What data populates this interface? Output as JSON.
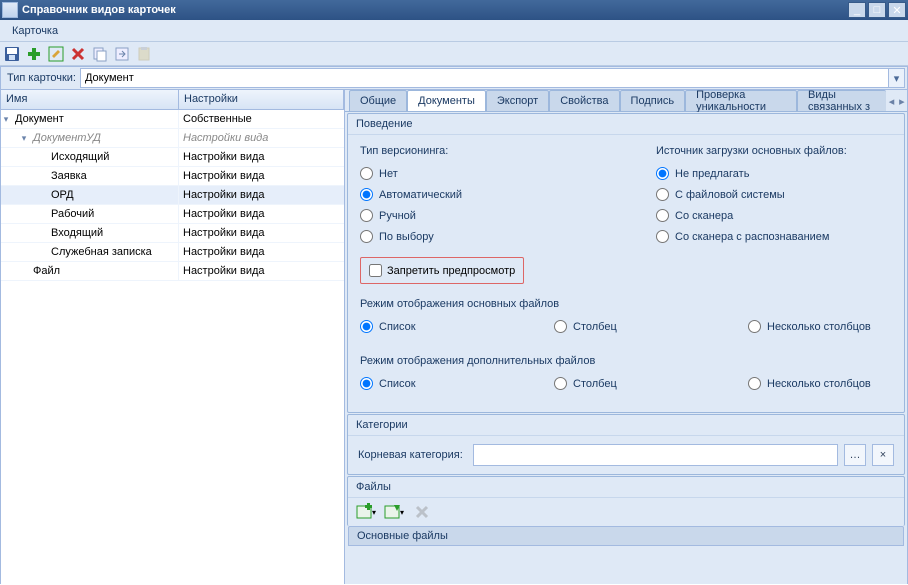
{
  "window": {
    "title": "Справочник видов карточек"
  },
  "menu": {
    "card": "Карточка"
  },
  "filter": {
    "label": "Тип карточки:",
    "value": "Документ"
  },
  "grid": {
    "col_name": "Имя",
    "col_settings": "Настройки"
  },
  "tree": [
    {
      "indent": 0,
      "toggle": "▾",
      "name": "Документ",
      "nameClass": "",
      "settings": "Собственные",
      "settingsClass": "",
      "sel": false
    },
    {
      "indent": 1,
      "toggle": "▾",
      "name": "ДокументУД",
      "nameClass": "italic",
      "settings": "Настройки вида",
      "settingsClass": "italic",
      "sel": false
    },
    {
      "indent": 2,
      "toggle": "",
      "name": "Исходящий",
      "nameClass": "",
      "settings": "Настройки вида",
      "settingsClass": "",
      "sel": false
    },
    {
      "indent": 2,
      "toggle": "",
      "name": "Заявка",
      "nameClass": "",
      "settings": "Настройки вида",
      "settingsClass": "",
      "sel": false
    },
    {
      "indent": 2,
      "toggle": "",
      "name": "ОРД",
      "nameClass": "",
      "settings": "Настройки вида",
      "settingsClass": "",
      "sel": true
    },
    {
      "indent": 2,
      "toggle": "",
      "name": "Рабочий",
      "nameClass": "",
      "settings": "Настройки вида",
      "settingsClass": "",
      "sel": false
    },
    {
      "indent": 2,
      "toggle": "",
      "name": "Входящий",
      "nameClass": "",
      "settings": "Настройки вида",
      "settingsClass": "",
      "sel": false
    },
    {
      "indent": 2,
      "toggle": "",
      "name": "Служебная записка",
      "nameClass": "",
      "settings": "Настройки вида",
      "settingsClass": "",
      "sel": false
    },
    {
      "indent": 1,
      "toggle": "",
      "name": "Файл",
      "nameClass": "",
      "settings": "Настройки вида",
      "settingsClass": "",
      "sel": false
    }
  ],
  "tabs": {
    "general": "Общие",
    "documents": "Документы",
    "export": "Экспорт",
    "properties": "Свойства",
    "sign": "Подпись",
    "unique": "Проверка уникальности",
    "linked": "Виды связанных з"
  },
  "behavior": {
    "head": "Поведение",
    "versioning_label": "Тип версионинга:",
    "versioning": {
      "none": "Нет",
      "auto": "Автоматический",
      "manual": "Ручной",
      "choice": "По выбору"
    },
    "source_label": "Источник загрузки основных файлов:",
    "source": {
      "none": "Не предлагать",
      "fs": "С файловой системы",
      "scanner": "Со сканера",
      "scanner_ocr": "Со сканера с распознаванием"
    },
    "no_preview": "Запретить предпросмотр",
    "main_mode_label": "Режим отображения основных файлов",
    "extra_mode_label": "Режим отображения дополнительных файлов",
    "mode": {
      "list": "Список",
      "column": "Столбец",
      "multi": "Несколько столбцов"
    }
  },
  "categories": {
    "head": "Категории",
    "root_label": "Корневая категория:",
    "value": ""
  },
  "files": {
    "head": "Файлы",
    "main_label": "Основные файлы"
  },
  "btn": {
    "ellipsis": "…",
    "clear": "×"
  }
}
